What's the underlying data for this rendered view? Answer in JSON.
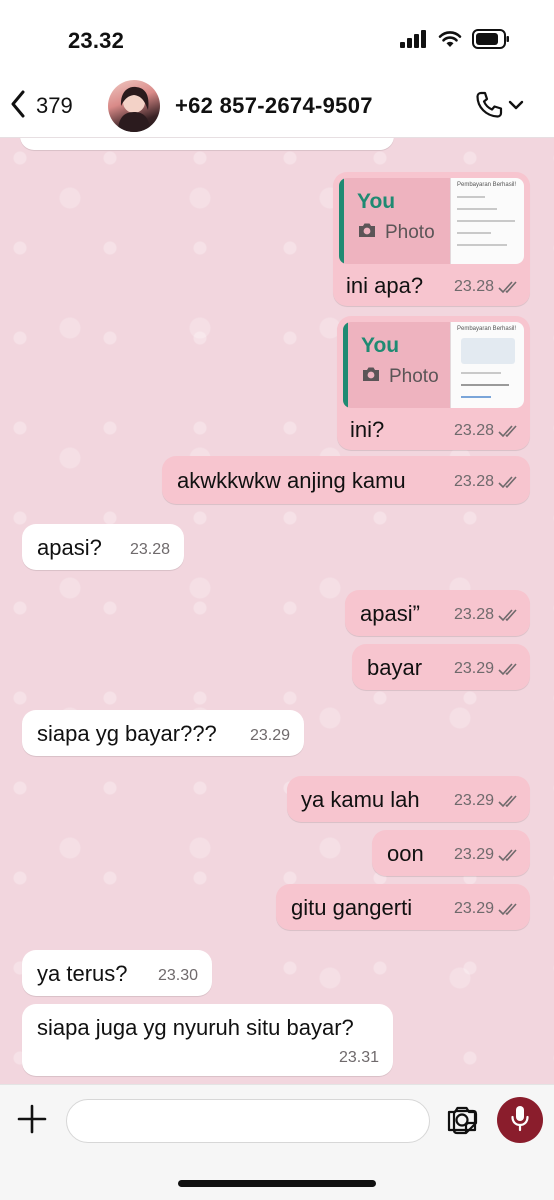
{
  "status_bar": {
    "time": "23.32",
    "icons": [
      "cellular-signal-icon",
      "wifi-icon",
      "battery-icon"
    ]
  },
  "header": {
    "back_count": "379",
    "contact_name": "+62 857-2674-9507",
    "icons": [
      "chevron-left-icon",
      "avatar",
      "phone-icon",
      "chevron-down-icon"
    ]
  },
  "colors": {
    "chat_background": "#f2d6de",
    "outgoing_bubble": "#f7c5cf",
    "incoming_bubble": "#ffffff",
    "quote_accent": "#1f8a72",
    "mic_button": "#8a1d2c"
  },
  "messages": [
    {
      "dir": "out",
      "quote": {
        "author": "You",
        "type": "Photo",
        "thumb_title": "Pembayaran Berhasil!"
      },
      "text": "ini apa?",
      "time": "23.28",
      "status": "read"
    },
    {
      "dir": "out",
      "quote": {
        "author": "You",
        "type": "Photo",
        "thumb_title": "Pembayaran Berhasil!"
      },
      "text": "ini?",
      "time": "23.28",
      "status": "read"
    },
    {
      "dir": "out",
      "text": "akwkkwkw anjing kamu",
      "time": "23.28",
      "status": "read"
    },
    {
      "dir": "in",
      "text": "apasi?",
      "time": "23.28"
    },
    {
      "dir": "out",
      "text": "apasi”",
      "time": "23.28",
      "status": "read"
    },
    {
      "dir": "out",
      "text": "bayar",
      "time": "23.29",
      "status": "read"
    },
    {
      "dir": "in",
      "text": "siapa yg bayar???",
      "time": "23.29"
    },
    {
      "dir": "out",
      "text": "ya kamu lah",
      "time": "23.29",
      "status": "read"
    },
    {
      "dir": "out",
      "text": "oon",
      "time": "23.29",
      "status": "read"
    },
    {
      "dir": "out",
      "text": "gitu gangerti",
      "time": "23.29",
      "status": "read"
    },
    {
      "dir": "in",
      "text": "ya terus?",
      "time": "23.30"
    },
    {
      "dir": "in",
      "text": "siapa juga yg nyuruh situ bayar?",
      "time": "23.31"
    }
  ],
  "input": {
    "value": "",
    "icons": [
      "plus-icon",
      "sticker-icon",
      "camera-icon",
      "mic-icon"
    ]
  }
}
